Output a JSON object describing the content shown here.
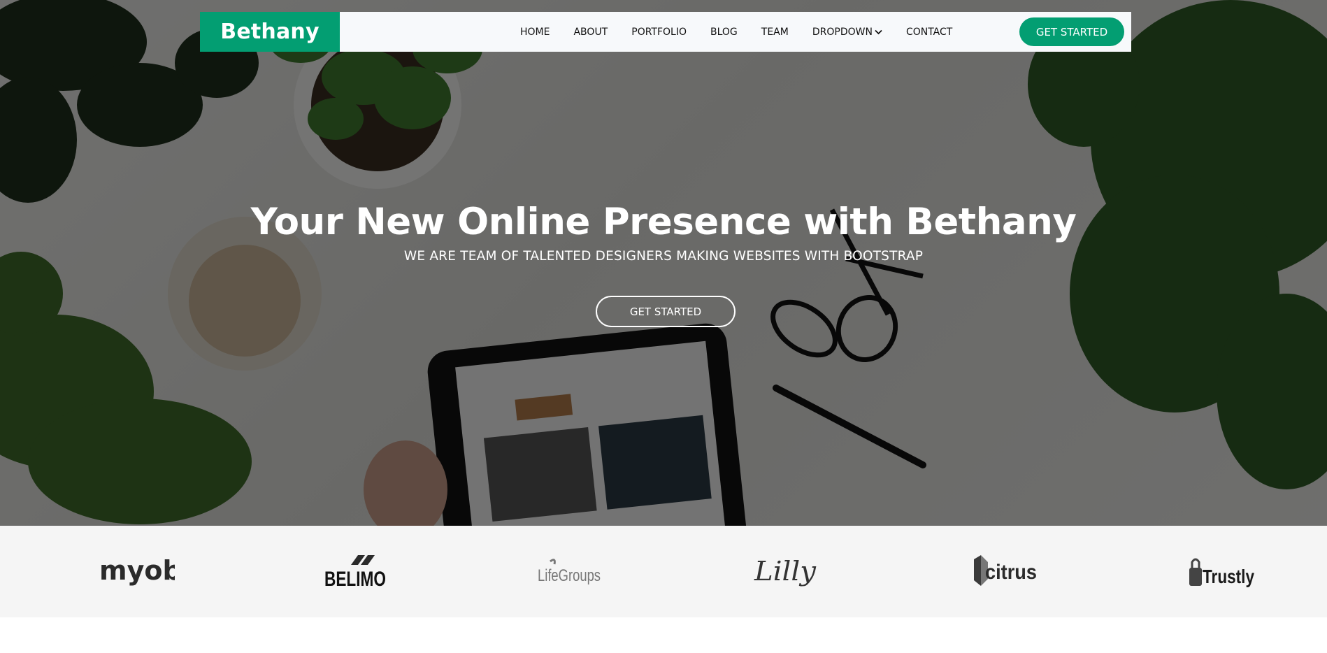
{
  "brand": {
    "name": "Bethany",
    "color": "#039e72"
  },
  "nav": {
    "items": [
      {
        "label": "HOME"
      },
      {
        "label": "ABOUT"
      },
      {
        "label": "PORTFOLIO"
      },
      {
        "label": "BLOG"
      },
      {
        "label": "TEAM"
      },
      {
        "label": "DROPDOWN",
        "icon": "chevron-down-icon"
      },
      {
        "label": "CONTACT"
      }
    ],
    "cta_label": "GET STARTED"
  },
  "hero": {
    "title": "Your New Online Presence with Bethany",
    "subtitle": "WE ARE TEAM OF TALENTED DESIGNERS MAKING WEBSITES WITH BOOTSTRAP",
    "cta_label": "GET STARTED"
  },
  "clients": {
    "logos": [
      {
        "name": "myob",
        "text": "myob"
      },
      {
        "name": "belimo",
        "text": "BELIMO"
      },
      {
        "name": "lifegroups",
        "text": "LifeGroups"
      },
      {
        "name": "lilly",
        "text": "Lilly"
      },
      {
        "name": "citrus",
        "text": "citrus"
      },
      {
        "name": "trustly",
        "text": "Trustly"
      }
    ]
  }
}
